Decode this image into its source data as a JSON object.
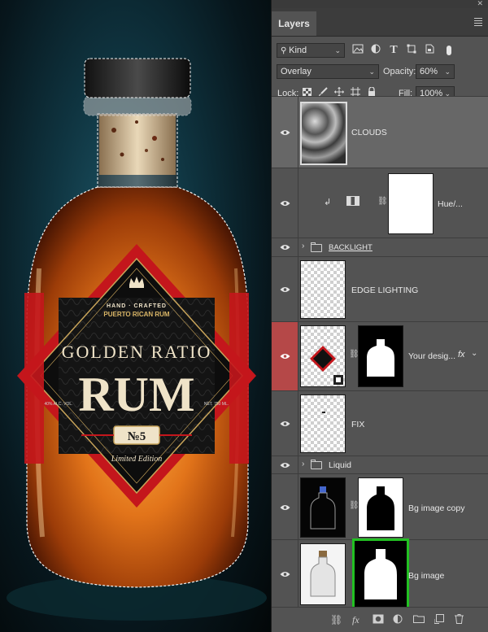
{
  "canvas": {
    "label_lines": [
      "HAND · CRAFTED",
      "PUERTO RICAN RUM"
    ],
    "brand": "GOLDEN RATIO",
    "product": "RUM",
    "number": "№5",
    "abv": "40% ALC. VOL.",
    "volume": "NET. 750 ML.",
    "edition": "Limited Edition"
  },
  "panel": {
    "tab_label": "Layers",
    "filter_kind": "Kind",
    "blend_mode": "Overlay",
    "opacity_label": "Opacity:",
    "opacity_value": "60%",
    "lock_label": "Lock:",
    "fill_label": "Fill:",
    "fill_value": "100%"
  },
  "layers": [
    {
      "name": "CLOUDS"
    },
    {
      "name": "Hue/..."
    },
    {
      "name": "BACKLIGHT"
    },
    {
      "name": "EDGE LIGHTING"
    },
    {
      "name": "Your desig...",
      "fx": "fx"
    },
    {
      "name": "FIX"
    },
    {
      "name": "Liquid"
    },
    {
      "name": "Bg image copy"
    },
    {
      "name": "Bg image"
    }
  ],
  "colors": {
    "panel_bg": "#535353",
    "active_layer": "#676767",
    "eye_highlight": "#b54848",
    "mask_highlight": "#22c022",
    "label_red": "#c4161c",
    "label_gold": "#c8a45a"
  }
}
